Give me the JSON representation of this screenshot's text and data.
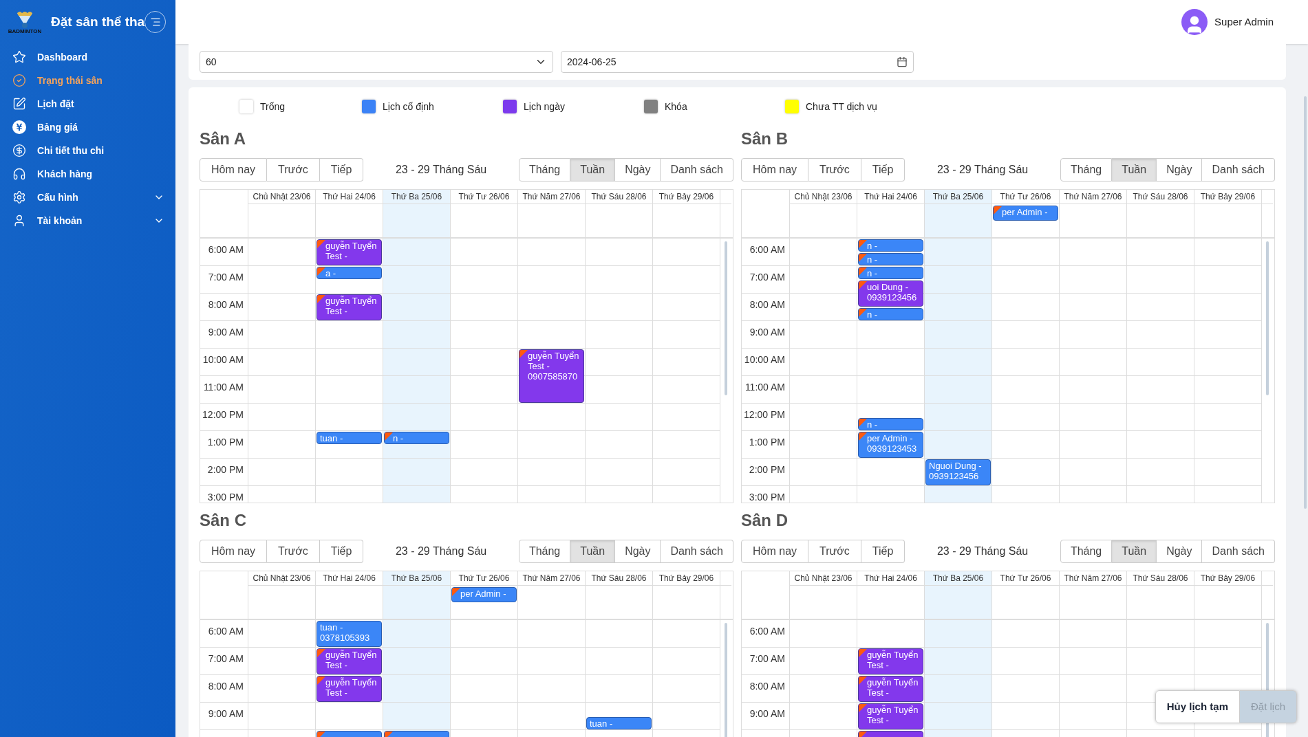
{
  "sidebar": {
    "logo_text": "BADMINTON",
    "title": "Đặt sân thể tha",
    "items": [
      {
        "label": "Dashboard",
        "selected": false,
        "expandable": false
      },
      {
        "label": "Trạng thái sân",
        "selected": true,
        "expandable": false
      },
      {
        "label": "Lịch đặt",
        "selected": false,
        "expandable": false
      },
      {
        "label": "Bảng giá",
        "selected": false,
        "expandable": false
      },
      {
        "label": "Chi tiết thu chi",
        "selected": false,
        "expandable": false
      },
      {
        "label": "Khách hàng",
        "selected": false,
        "expandable": false
      },
      {
        "label": "Cấu hình",
        "selected": false,
        "expandable": true
      },
      {
        "label": "Tài khoản",
        "selected": false,
        "expandable": true
      }
    ]
  },
  "header": {
    "user": "Super Admin"
  },
  "filters": {
    "duration": "60",
    "date": "2024-06-25"
  },
  "legend": [
    {
      "label": "Trống",
      "color": "#ffffff"
    },
    {
      "label": "Lịch cố định",
      "color": "#3b82f6"
    },
    {
      "label": "Lịch ngày",
      "color": "#7c3aed"
    },
    {
      "label": "Khóa",
      "color": "#808080"
    },
    {
      "label": "Chưa TT dịch vụ",
      "color": "#ffff00"
    }
  ],
  "courts": [
    {
      "title": "Sân A",
      "nav": [
        "Hôm nay",
        "Trước",
        "Tiếp"
      ],
      "range": "23 - 29 Tháng Sáu",
      "views": [
        {
          "label": "Tháng",
          "selected": false
        },
        {
          "label": "Tuần",
          "selected": true
        },
        {
          "label": "Ngày",
          "selected": false
        },
        {
          "label": "Danh sách",
          "selected": false
        }
      ],
      "hours": [
        "6:00 AM",
        "7:00 AM",
        "8:00 AM",
        "9:00 AM",
        "10:00 AM",
        "11:00 AM",
        "12:00 PM",
        "1:00 PM",
        "2:00 PM",
        "3:00 PM"
      ],
      "days": [
        {
          "label": "Chủ Nhật 23/06",
          "today": false
        },
        {
          "label": "Thứ Hai 24/06",
          "today": false,
          "timeline": [
            {
              "kind": "daily",
              "paid": true,
              "text": "guyễn Tuyển Test -"
            },
            {
              "kind": "continued"
            },
            {
              "kind": "fixed",
              "paid": true,
              "text": "a -"
            },
            {
              "kind": "gap"
            },
            {
              "kind": "daily",
              "paid": true,
              "text": "guyễn Tuyển Test -"
            },
            {
              "kind": "continued"
            },
            {
              "kind": "gap"
            },
            {
              "kind": "gap"
            },
            {
              "kind": "gap"
            },
            {
              "kind": "gap"
            },
            {
              "kind": "gap"
            },
            {
              "kind": "gap"
            },
            {
              "kind": "gap"
            },
            {
              "kind": "gap"
            },
            {
              "kind": "fixed",
              "paid": false,
              "text": "tuan -"
            }
          ]
        },
        {
          "label": "Thứ Ba 25/06",
          "today": true,
          "timeline": [
            {
              "kind": "gap"
            },
            {
              "kind": "gap"
            },
            {
              "kind": "gap"
            },
            {
              "kind": "gap"
            },
            {
              "kind": "gap"
            },
            {
              "kind": "gap"
            },
            {
              "kind": "gap"
            },
            {
              "kind": "gap"
            },
            {
              "kind": "gap"
            },
            {
              "kind": "gap"
            },
            {
              "kind": "gap"
            },
            {
              "kind": "gap"
            },
            {
              "kind": "gap"
            },
            {
              "kind": "gap"
            },
            {
              "kind": "fixed",
              "paid": true,
              "text": "n -"
            }
          ]
        },
        {
          "label": "Thứ Tư 26/06",
          "today": false
        },
        {
          "label": "Thứ Năm 27/06",
          "today": false,
          "timeline": [
            {
              "kind": "gap"
            },
            {
              "kind": "gap"
            },
            {
              "kind": "gap"
            },
            {
              "kind": "gap"
            },
            {
              "kind": "gap"
            },
            {
              "kind": "gap"
            },
            {
              "kind": "gap"
            },
            {
              "kind": "gap"
            },
            {
              "kind": "daily",
              "paid": true,
              "text": "guyễn Tuyển Test - 0907585870"
            },
            {
              "kind": "continued"
            },
            {
              "kind": "continued"
            },
            {
              "kind": "continued"
            }
          ]
        },
        {
          "label": "Thứ Sáu 28/06",
          "today": false
        },
        {
          "label": "Thứ Bảy 29/06",
          "today": false
        }
      ]
    },
    {
      "title": "Sân B",
      "nav": [
        "Hôm nay",
        "Trước",
        "Tiếp"
      ],
      "range": "23 - 29 Tháng Sáu",
      "views": [
        {
          "label": "Tháng",
          "selected": false
        },
        {
          "label": "Tuần",
          "selected": true
        },
        {
          "label": "Ngày",
          "selected": false
        },
        {
          "label": "Danh sách",
          "selected": false
        }
      ],
      "hours": [
        "6:00 AM",
        "7:00 AM",
        "8:00 AM",
        "9:00 AM",
        "10:00 AM",
        "11:00 AM",
        "12:00 PM",
        "1:00 PM",
        "2:00 PM",
        "3:00 PM"
      ],
      "days": [
        {
          "label": "Chủ Nhật 23/06",
          "today": false
        },
        {
          "label": "Thứ Hai 24/06",
          "today": false,
          "timeline": [
            {
              "kind": "fixed",
              "paid": true,
              "text": "n -"
            },
            {
              "kind": "fixed",
              "paid": true,
              "text": "n -"
            },
            {
              "kind": "fixed",
              "paid": true,
              "text": "n -"
            },
            {
              "kind": "daily",
              "paid": true,
              "text": "uoi Dung - 0939123456"
            },
            {
              "kind": "continued"
            },
            {
              "kind": "fixed",
              "paid": true,
              "text": "n -"
            },
            {
              "kind": "gap"
            },
            {
              "kind": "gap"
            },
            {
              "kind": "gap"
            },
            {
              "kind": "gap"
            },
            {
              "kind": "gap"
            },
            {
              "kind": "gap"
            },
            {
              "kind": "gap"
            },
            {
              "kind": "fixed",
              "paid": true,
              "text": "n -"
            },
            {
              "kind": "fixed",
              "paid": true,
              "text": "per Admin - 0939123453"
            },
            {
              "kind": "continued"
            }
          ]
        },
        {
          "label": "Thứ Ba 25/06",
          "today": true,
          "timeline": [
            {
              "kind": "gap"
            },
            {
              "kind": "gap"
            },
            {
              "kind": "gap"
            },
            {
              "kind": "gap"
            },
            {
              "kind": "gap"
            },
            {
              "kind": "gap"
            },
            {
              "kind": "gap"
            },
            {
              "kind": "gap"
            },
            {
              "kind": "gap"
            },
            {
              "kind": "gap"
            },
            {
              "kind": "gap"
            },
            {
              "kind": "gap"
            },
            {
              "kind": "gap"
            },
            {
              "kind": "gap"
            },
            {
              "kind": "gap"
            },
            {
              "kind": "gap"
            },
            {
              "kind": "fixed",
              "paid": false,
              "text": "Nguoi Dung - 0939123456"
            },
            {
              "kind": "continued"
            }
          ]
        },
        {
          "label": "Thứ Tư 26/06",
          "today": false,
          "all_day": [
            {
              "kind": "fixed",
              "paid": true,
              "text": "per Admin -"
            }
          ]
        },
        {
          "label": "Thứ Năm 27/06",
          "today": false
        },
        {
          "label": "Thứ Sáu 28/06",
          "today": false
        },
        {
          "label": "Thứ Bảy 29/06",
          "today": false
        }
      ]
    },
    {
      "title": "Sân C",
      "nav": [
        "Hôm nay",
        "Trước",
        "Tiếp"
      ],
      "range": "23 - 29 Tháng Sáu",
      "views": [
        {
          "label": "Tháng",
          "selected": false
        },
        {
          "label": "Tuần",
          "selected": true
        },
        {
          "label": "Ngày",
          "selected": false
        },
        {
          "label": "Danh sách",
          "selected": false
        }
      ],
      "hours": [
        "6:00 AM",
        "7:00 AM",
        "8:00 AM",
        "9:00 AM"
      ],
      "days": [
        {
          "label": "Chủ Nhật 23/06",
          "today": false
        },
        {
          "label": "Thứ Hai 24/06",
          "today": false,
          "timeline": [
            {
              "kind": "fixed",
              "paid": false,
              "text": "tuan - 0378105393"
            },
            {
              "kind": "continued"
            },
            {
              "kind": "daily",
              "paid": true,
              "text": "guyễn Tuyển Test -"
            },
            {
              "kind": "continued"
            },
            {
              "kind": "daily",
              "paid": true,
              "text": "guyễn Tuyển Test -"
            },
            {
              "kind": "continued"
            },
            {
              "kind": "gap"
            },
            {
              "kind": "gap"
            },
            {
              "kind": "fixed",
              "paid": true
            }
          ]
        },
        {
          "label": "Thứ Ba 25/06",
          "today": true,
          "timeline": [
            {
              "kind": "gap"
            },
            {
              "kind": "gap"
            },
            {
              "kind": "gap"
            },
            {
              "kind": "gap"
            },
            {
              "kind": "gap"
            },
            {
              "kind": "gap"
            },
            {
              "kind": "gap"
            },
            {
              "kind": "gap"
            },
            {
              "kind": "fixed",
              "paid": true
            }
          ]
        },
        {
          "label": "Thứ Tư 26/06",
          "today": false,
          "all_day": [
            {
              "kind": "fixed",
              "paid": true,
              "text": "per Admin -"
            }
          ]
        },
        {
          "label": "Thứ Năm 27/06",
          "today": false
        },
        {
          "label": "Thứ Sáu 28/06",
          "today": false,
          "timeline": [
            {
              "kind": "gap"
            },
            {
              "kind": "gap"
            },
            {
              "kind": "gap"
            },
            {
              "kind": "gap"
            },
            {
              "kind": "gap"
            },
            {
              "kind": "gap"
            },
            {
              "kind": "gap"
            },
            {
              "kind": "fixed",
              "paid": false,
              "text": "tuan -"
            }
          ]
        },
        {
          "label": "Thứ Bảy 29/06",
          "today": false
        }
      ]
    },
    {
      "title": "Sân D",
      "nav": [
        "Hôm nay",
        "Trước",
        "Tiếp"
      ],
      "range": "23 - 29 Tháng Sáu",
      "views": [
        {
          "label": "Tháng",
          "selected": false
        },
        {
          "label": "Tuần",
          "selected": true
        },
        {
          "label": "Ngày",
          "selected": false
        },
        {
          "label": "Danh sách",
          "selected": false
        }
      ],
      "hours": [
        "6:00 AM",
        "7:00 AM",
        "8:00 AM",
        "9:00 AM"
      ],
      "days": [
        {
          "label": "Chủ Nhật 23/06",
          "today": false
        },
        {
          "label": "Thứ Hai 24/06",
          "today": false,
          "timeline": [
            {
              "kind": "gap"
            },
            {
              "kind": "gap"
            },
            {
              "kind": "daily",
              "paid": true,
              "text": "guyễn Tuyển Test -"
            },
            {
              "kind": "continued"
            },
            {
              "kind": "daily",
              "paid": true,
              "text": "guyễn Tuyển Test -"
            },
            {
              "kind": "continued"
            },
            {
              "kind": "daily",
              "paid": true,
              "text": "guyễn Tuyển Test -"
            },
            {
              "kind": "continued"
            },
            {
              "kind": "daily",
              "paid": true
            },
            {
              "kind": "continued"
            }
          ]
        },
        {
          "label": "Thứ Ba 25/06",
          "today": true
        },
        {
          "label": "Thứ Tư 26/06",
          "today": false
        },
        {
          "label": "Thứ Năm 27/06",
          "today": false
        },
        {
          "label": "Thứ Sáu 28/06",
          "today": false
        },
        {
          "label": "Thứ Bảy 29/06",
          "today": false
        }
      ]
    }
  ],
  "actions": [
    {
      "label": "Hủy lịch tạm",
      "disabled": false
    },
    {
      "label": "Đặt lịch",
      "disabled": true
    }
  ]
}
